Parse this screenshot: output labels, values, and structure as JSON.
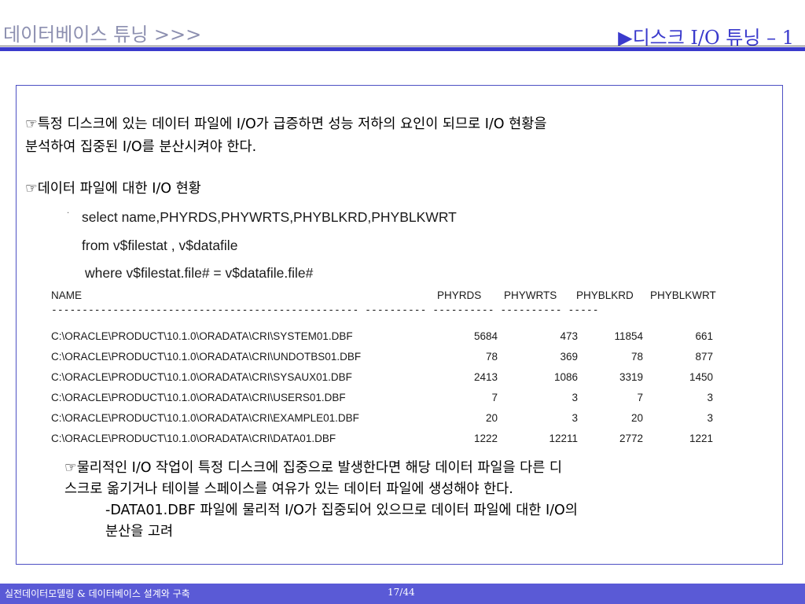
{
  "header": {
    "left_title": "데이터베이스 튜닝 >>>",
    "right_title": "▶디스크 I/O 튜닝 – 1"
  },
  "content": {
    "bullet_symbol": "☞",
    "p1_line1": "특정 디스크에 있는 데이터 파일에 I/O가 급증하면 성능 저하의 요인이 되므로 I/O 현황을",
    "p1_line2": "분석하여 집중된 I/O를 분산시켜야 한다.",
    "p2": "데이터 파일에 대한 I/O 현황",
    "sql_line1": "select name,PHYRDS,PHYWRTS,PHYBLKRD,PHYBLKWRT",
    "sql_line2": "from v$filestat , v$datafile",
    "sql_line3": "where v$filestat.file# = v$datafile.file#",
    "p3_line1": "물리적인 I/O 작업이 특정 디스크에 집중으로 발생한다면 해당 데이터 파일을 다른 디",
    "p3_line2": "스크로 옮기거나 테이블 스페이스를 여유가 있는 데이터 파일에 생성해야 한다.",
    "p3_line3": "-DATA01.DBF 파일에 물리적 I/O가 집중되어 있으므로 데이터 파일에 대한 I/O의",
    "p3_line4": "분산을 고려"
  },
  "table": {
    "columns": [
      "NAME",
      "PHYRDS",
      "PHYWRTS",
      "PHYBLKRD",
      "PHYBLKWRT"
    ],
    "separator": "-------------------------------------------------- ---------- ---------- ---------- -----",
    "rows": [
      {
        "name": "C:\\ORACLE\\PRODUCT\\10.1.0\\ORADATA\\CRI\\SYSTEM01.DBF",
        "phyrds": "5684",
        "phywrts": "473",
        "phyblkrd": "11854",
        "phyblkwrt": "661"
      },
      {
        "name": "C:\\ORACLE\\PRODUCT\\10.1.0\\ORADATA\\CRI\\UNDOTBS01.DBF",
        "phyrds": "78",
        "phywrts": "369",
        "phyblkrd": "78",
        "phyblkwrt": "877"
      },
      {
        "name": "C:\\ORACLE\\PRODUCT\\10.1.0\\ORADATA\\CRI\\SYSAUX01.DBF",
        "phyrds": "2413",
        "phywrts": "1086",
        "phyblkrd": "3319",
        "phyblkwrt": "1450"
      },
      {
        "name": "C:\\ORACLE\\PRODUCT\\10.1.0\\ORADATA\\CRI\\USERS01.DBF",
        "phyrds": "7",
        "phywrts": "3",
        "phyblkrd": "7",
        "phyblkwrt": "3"
      },
      {
        "name": "C:\\ORACLE\\PRODUCT\\10.1.0\\ORADATA\\CRI\\EXAMPLE01.DBF",
        "phyrds": "20",
        "phywrts": "3",
        "phyblkrd": "20",
        "phyblkwrt": "3"
      },
      {
        "name": "C:\\ORACLE\\PRODUCT\\10.1.0\\ORADATA\\CRI\\DATA01.DBF",
        "phyrds": "1222",
        "phywrts": "12211",
        "phyblkrd": "2772",
        "phyblkwrt": "1221"
      }
    ]
  },
  "footer": {
    "left": "실전데이터모델링 & 데이터베이스 설계와 구축",
    "page": "17/44"
  },
  "colors": {
    "accent": "#3a3acc",
    "header_muted": "#8c8fb0",
    "footer_bg": "#5a5ad6",
    "box_border": "#4d50c4"
  }
}
